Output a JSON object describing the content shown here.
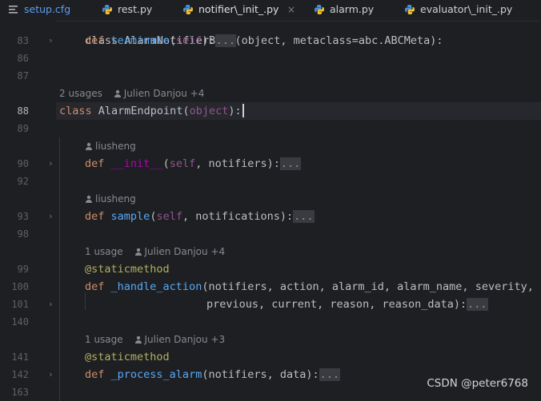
{
  "tabs": [
    {
      "label": "setup.cfg",
      "icon": "menu-lines-icon"
    },
    {
      "label": "rest.py",
      "icon": "python-icon"
    },
    {
      "label": "notifier\\_init_.py",
      "icon": "python-icon",
      "active": true,
      "close": "×"
    },
    {
      "label": "alarm.py",
      "icon": "python-icon"
    },
    {
      "label": "evaluator\\_init_.py",
      "icon": "python-icon"
    }
  ],
  "lines": [
    {
      "num": "83",
      "fold": "›"
    },
    {
      "num": "86"
    },
    {
      "num": "87"
    },
    {
      "num": "88",
      "current": true
    },
    {
      "num": "89"
    },
    {
      "num": "90",
      "fold": "›"
    },
    {
      "num": "92"
    },
    {
      "num": "93",
      "fold": "›"
    },
    {
      "num": "98"
    },
    {
      "num": "99"
    },
    {
      "num": "100"
    },
    {
      "num": "101",
      "fold": "›"
    },
    {
      "num": "140"
    },
    {
      "num": "141"
    },
    {
      "num": "142",
      "fold": "›"
    },
    {
      "num": "163"
    }
  ],
  "code": {
    "l82": "class AlarmNotifierBase(object, metaclass=abc.ABCMeta):",
    "l83_def": "def",
    "l83_name": "terminate",
    "l83_self": "self",
    "l88_kw": "class",
    "l88_name": "AlarmEndpoint",
    "l88_base": "object",
    "l90_def": "def",
    "l90_name": "__init__",
    "l90_self": "self",
    "l90_rest": ", notifiers):",
    "l93_def": "def",
    "l93_name": "sample",
    "l93_self": "self",
    "l93_rest": ", notifications):",
    "l99_deco": "@staticmethod",
    "l100_def": "def",
    "l100_name": "_handle_action",
    "l100_rest": "(notifiers, action, alarm_id, alarm_name, severity,",
    "l101_rest": "previous, current, reason, reason_data):",
    "l141_deco": "@staticmethod",
    "l142_def": "def",
    "l142_name": "_process_alarm",
    "l142_rest": "(notifiers, data):",
    "dots": "..."
  },
  "hints": {
    "h88_usages": "2 usages",
    "h88_author": "Julien Danjou +4",
    "h90_author": "liusheng",
    "h93_author": "liusheng",
    "h99_usages": "1 usage",
    "h99_author": "Julien Danjou +4",
    "h141_usages": "1 usage",
    "h141_author": "Julien Danjou +3"
  },
  "watermark": "CSDN @peter6768",
  "colors": {
    "background": "#1e1f22",
    "keyword": "#cf8e6d",
    "function": "#56a8f5",
    "self": "#94558d",
    "magic": "#b200b2",
    "decorator": "#b3ae60",
    "active_tab_underline": "#3574f0"
  }
}
